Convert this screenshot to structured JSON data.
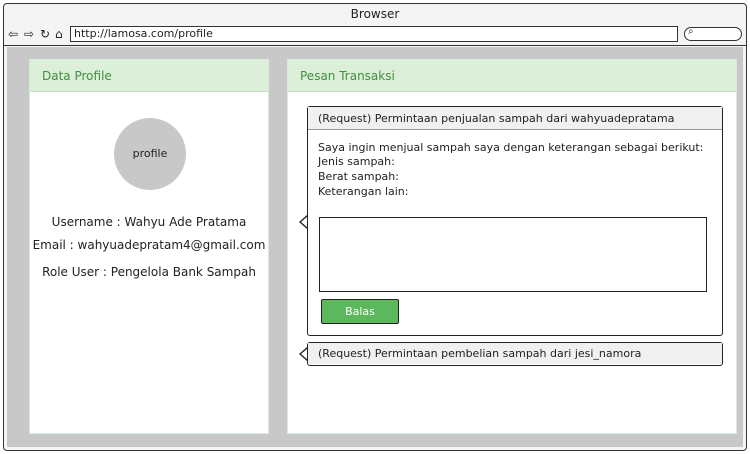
{
  "browser": {
    "title": "Browser",
    "url": "http://lamosa.com/profile"
  },
  "profile_panel": {
    "header": "Data Profile",
    "avatar_label": "profile",
    "username": "Username : Wahyu Ade Pratama",
    "email": "Email : wahyuadepratam4@gmail.com",
    "role": "Role User : Pengelola Bank Sampah"
  },
  "transactions_panel": {
    "header": "Pesan Transaksi",
    "messages": [
      {
        "title": "(Request) Permintaan penjualan sampah dari wahyuadepratama",
        "body_intro": "Saya ingin menjual sampah saya dengan keterangan sebagai berikut:",
        "field_type": "Jenis sampah:",
        "field_weight": "Berat sampah:",
        "field_notes": "Keterangan lain:",
        "reply_label": "Balas"
      },
      {
        "title": "(Request) Permintaan pembelian sampah dari jesi_namora"
      }
    ]
  },
  "colors": {
    "panel_header_bg": "#dcefd9",
    "panel_header_text": "#3f8f3f",
    "reply_button": "#5cb85c",
    "content_bg": "#c8c8c8"
  }
}
